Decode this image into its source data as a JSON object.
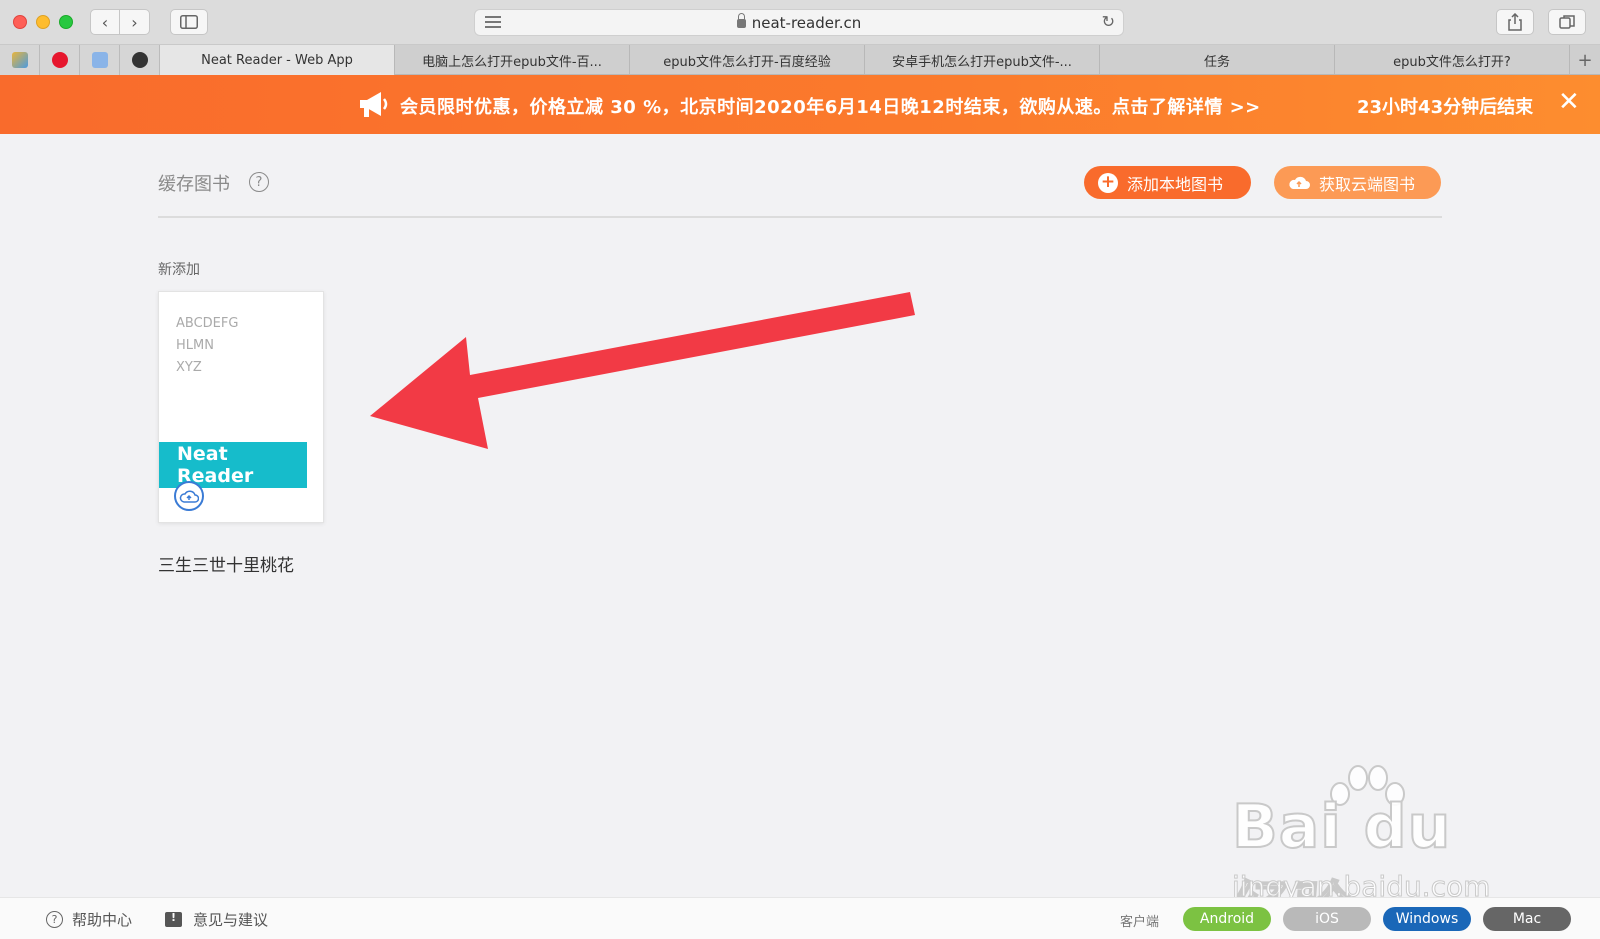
{
  "browser": {
    "url": "neat-reader.cn",
    "tabs": [
      {
        "label": "Neat Reader - Web App",
        "active": true
      },
      {
        "label": "电脑上怎么打开epub文件-百...",
        "active": false
      },
      {
        "label": "epub文件怎么打开-百度经验",
        "active": false
      },
      {
        "label": "安卓手机怎么打开epub文件-...",
        "active": false
      },
      {
        "label": "任务",
        "active": false
      },
      {
        "label": "epub文件怎么打开?",
        "active": false
      }
    ],
    "new_tab_glyph": "+",
    "favicons": [
      "bookmarks-icon",
      "weibo-icon",
      "reading-list-icon",
      "compass-icon"
    ]
  },
  "banner": {
    "text": "会员限时优惠，价格立减 30 %，北京时间2020年6月14日晚12时结束，欲购从速。点击了解详情 >>",
    "countdown": "23小时43分钟后结束",
    "close_glyph": "✕",
    "bg_color": "#f96b2c"
  },
  "header": {
    "title": "缓存图书",
    "help_glyph": "?",
    "add_local_label": "添加本地图书",
    "get_cloud_label": "获取云端图书"
  },
  "library": {
    "section_label": "新添加",
    "books": [
      {
        "cover_lines": [
          "ABCDEFG",
          "HLMN",
          "XYZ"
        ],
        "cover_brand": "Neat Reader",
        "title": "三生三世十里桃花",
        "accent_color": "#16bccb"
      }
    ]
  },
  "watermark": {
    "big": "Bai du 经验",
    "small": "jingyan.baidu.com"
  },
  "footer": {
    "help_label": "帮助中心",
    "feedback_label": "意见与建议",
    "client_label": "客户端",
    "platforms": [
      "Android",
      "iOS",
      "Windows",
      "Mac"
    ]
  }
}
